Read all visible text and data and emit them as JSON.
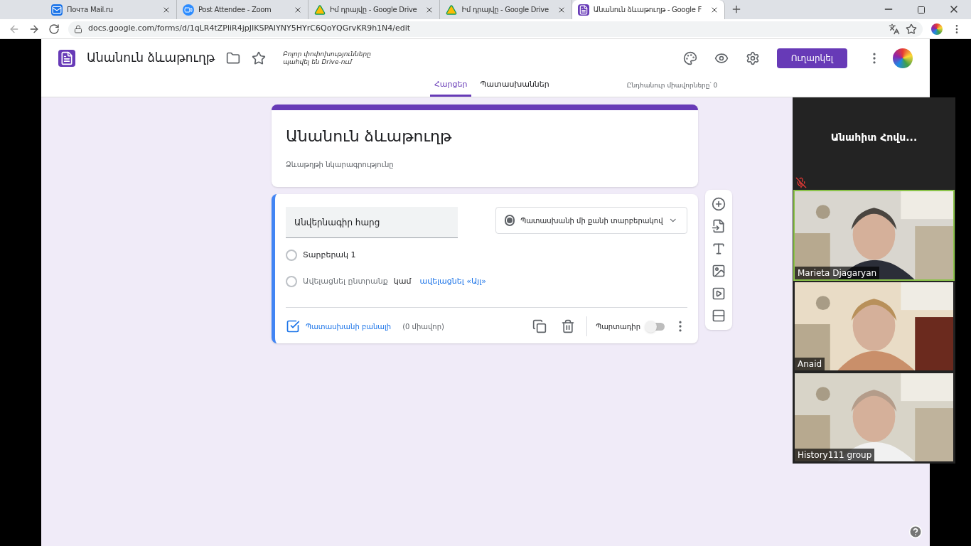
{
  "browser": {
    "tabs": [
      {
        "kind": "mail",
        "title": "Почта Mail.ru",
        "selected": false
      },
      {
        "kind": "zoom",
        "title": "Post Attendee - Zoom",
        "selected": false
      },
      {
        "kind": "drive",
        "title": "Իմ դրայվը - Google Drive",
        "selected": false
      },
      {
        "kind": "drive",
        "title": "Իմ դրայվը - Google Drive",
        "selected": false
      },
      {
        "kind": "forms",
        "title": "Անանուն ձևաթուղթ - Google F",
        "selected": true
      }
    ],
    "url": "docs.google.com/forms/d/1qLR4tZPliR4jpJIKSPAIYNY5HYrC6QoYQGrvKR9h1N4/edit"
  },
  "header": {
    "title": "Անանուն ձևաթուղթ",
    "save_note": "Բոլոր փոփոխությունները պահվել են Drive-ում",
    "send": "Ուղարկել",
    "tabs": [
      {
        "label": "Հարցեր",
        "selected": true
      },
      {
        "label": "Պատասխաններ",
        "selected": false
      }
    ],
    "points": "Ընդհանուր միավորները՝ 0"
  },
  "form": {
    "title": "Անանուն ձևաթուղթ",
    "description": "Ձևաթղթի նկարագրությունը",
    "question": {
      "value": "Անվերնագիր հարց",
      "type": "Պատասխանի մի քանի տարբերակով",
      "options": [
        "Տարբերակ 1"
      ],
      "add_option": "Ավելացնել ընտրանք",
      "or": "կամ",
      "add_other": "ավելացնել «Այլ»",
      "answer_key": "Պատասխանի բանալի",
      "points": "(0 միավոր)",
      "required_label": "Պարտադիր",
      "required": false
    }
  },
  "zoom": {
    "speaker": "Անահիտ Հովս...",
    "muted": true,
    "participants": [
      {
        "name": "Marieta Djagaryan",
        "speaking": true
      },
      {
        "name": "Anaid",
        "speaking": false
      },
      {
        "name": "History111 group",
        "speaking": false
      }
    ]
  }
}
